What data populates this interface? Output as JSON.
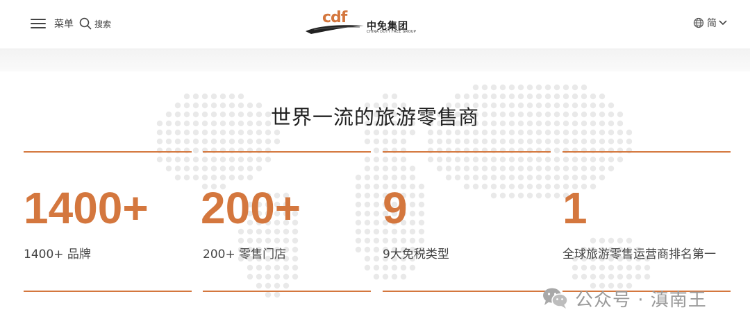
{
  "header": {
    "menu_label": "菜单",
    "search_label": "搜索",
    "logo": {
      "mark": "cdf",
      "name_cn": "中免集团",
      "name_en": "CHINA DUTY FREE GROUP"
    },
    "lang_label": "简"
  },
  "main": {
    "title": "世界一流的旅游零售商",
    "stats": [
      {
        "number": "1400+",
        "label": "1400+ 品牌"
      },
      {
        "number": "200+",
        "label": "200+ 零售门店"
      },
      {
        "number": "9",
        "label": "9大免税类型"
      },
      {
        "number": "1",
        "label": "全球旅游零售运营商排名第一"
      }
    ]
  },
  "watermark": {
    "text": "公众号 · 滇南王"
  },
  "colors": {
    "accent": "#d4773e",
    "map_dots": "#e9e9e9"
  },
  "icons": [
    "menu-icon",
    "search-icon",
    "globe-icon",
    "chevron-down-icon",
    "wechat-icon"
  ]
}
